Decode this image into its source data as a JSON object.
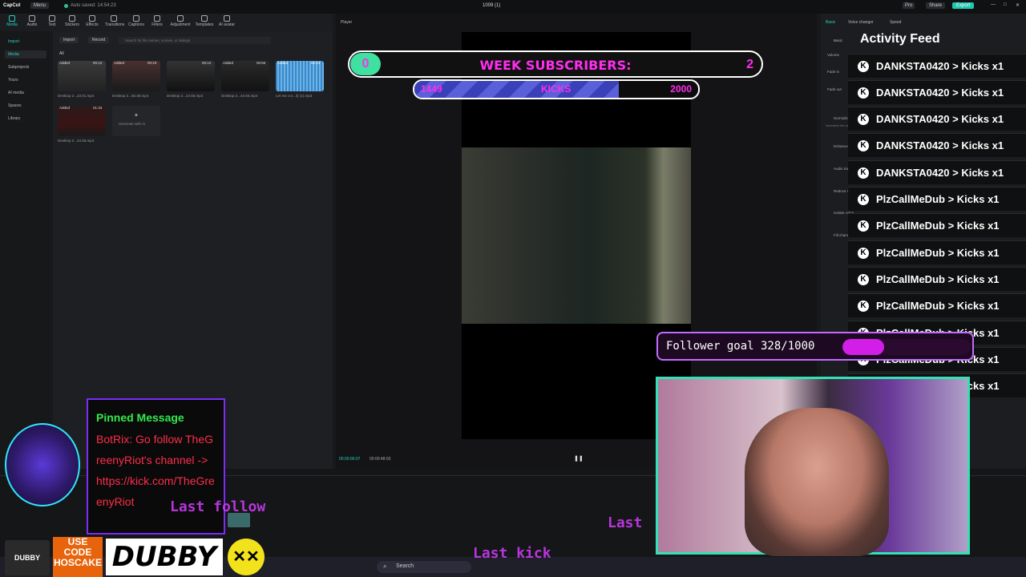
{
  "app": {
    "name": "CapCut",
    "menu_label": "Menu",
    "autosave": "Auto saved: 14:54:23",
    "project_title": "1009 (1)",
    "pro_label": "Pro",
    "share_label": "Share",
    "export_label": "Export"
  },
  "toolbar": {
    "items": [
      "Media",
      "Audio",
      "Text",
      "Stickers",
      "Effects",
      "Transitions",
      "Captions",
      "Filters",
      "Adjustment",
      "Templates",
      "AI avatar"
    ]
  },
  "sidebar": {
    "import": "Import",
    "items": [
      "Media",
      "Subprojects",
      "Yours",
      "AI media",
      "Spaces",
      "Library"
    ]
  },
  "media": {
    "import_button": "Import",
    "record_button": "Record",
    "search_placeholder": "Search for file names, scenes, or dialogs",
    "filter_all": "All",
    "clips": [
      {
        "badge": "Added",
        "duration": "00:12",
        "name": "Desktop 2...23.01.mp4"
      },
      {
        "badge": "Added",
        "duration": "00:23",
        "name": "Desktop 2...56.38.mp4"
      },
      {
        "badge": "",
        "duration": "00:12",
        "name": "Desktop 2...24.56.mp4"
      },
      {
        "badge": "Added",
        "duration": "00:55",
        "name": "Desktop 2...44.56.mp4"
      },
      {
        "badge": "Added",
        "duration": "00:23",
        "name": "Let me cor...it) (1).mp3"
      },
      {
        "badge": "Added",
        "duration": "01:33",
        "name": "Desktop 2...34.56.mp4"
      }
    ],
    "generate_label": "Generate with AI"
  },
  "player": {
    "label": "Player",
    "current_time": "00:00:00:07",
    "total_time": "00:00:48:03"
  },
  "right_panel": {
    "tabs": [
      "Basic",
      "Voice changer",
      "Speed"
    ],
    "section": "Basic",
    "rows": [
      "Volume",
      "Fade in",
      "Fade out",
      "Normalize loudness",
      "Enhance voice",
      "Audio tracks",
      "Reduce noise",
      "Isolate voice",
      "Fill channel"
    ],
    "normalize_hint": "Normalize the loudness of the selected clip or clips to a target level."
  },
  "overlay": {
    "week_subs": {
      "count": "0",
      "title": "WEEK SUBSCRIBERS:",
      "goal": "2"
    },
    "kicks": {
      "current": "1449",
      "label": "KICKS",
      "goal": "2000",
      "progress": 0.72
    },
    "activity_feed": {
      "title": "Activity Feed",
      "items": [
        "DANKSTA0420 > Kicks x1",
        "DANKSTA0420 > Kicks x1",
        "DANKSTA0420 > Kicks x1",
        "DANKSTA0420 > Kicks x1",
        "DANKSTA0420 > Kicks x1",
        "PlzCallMeDub > Kicks x1",
        "PlzCallMeDub > Kicks x1",
        "PlzCallMeDub > Kicks x1",
        "PlzCallMeDub > Kicks x1",
        "PlzCallMeDub > Kicks x1",
        "PlzCallMeDub > Kicks x1",
        "PlzCallMeDub > Kicks x1",
        "PlzCallMeDub > Kicks x1"
      ]
    },
    "follower_goal": {
      "text": "Follower goal 328/1000",
      "progress": 0.328
    },
    "pinned": {
      "title": "Pinned Message",
      "body": "BotRix: Go follow TheGreenyRiot's channel -> https://kick.com/TheGreenyRiot"
    },
    "sponsor": {
      "line1": "USE",
      "line2": "CODE",
      "line3": "HOSCAKE",
      "brand": "DUBBY",
      "can_label": "DUBBY"
    },
    "glow_texts": [
      "Last follow",
      "Last",
      "Last kick"
    ]
  },
  "taskbar": {
    "search": "Search"
  }
}
